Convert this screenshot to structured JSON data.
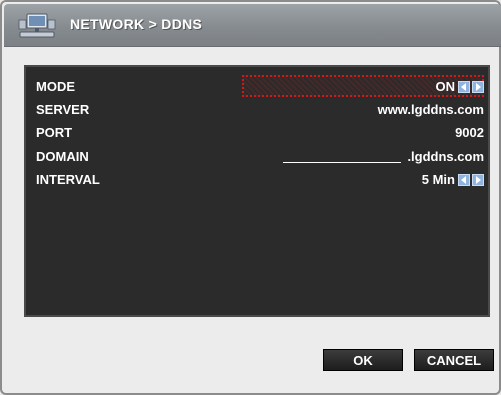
{
  "header": {
    "title": "NETWORK > DDNS",
    "icon": "network-monitor-icon"
  },
  "settings": {
    "mode": {
      "label": "MODE",
      "value": "ON"
    },
    "server": {
      "label": "SERVER",
      "value": "www.lgddns.com"
    },
    "port": {
      "label": "PORT",
      "value": "9002"
    },
    "domain": {
      "label": "DOMAIN",
      "value": "",
      "suffix": ".lgddns.com"
    },
    "interval": {
      "label": "INTERVAL",
      "value": "5 Min"
    }
  },
  "buttons": {
    "ok": "OK",
    "cancel": "CANCEL"
  },
  "colors": {
    "panel": "#2b2b2b",
    "titlebar": "#868b90",
    "highlight": "#d01a1a",
    "arrow": "#8fb4e0"
  }
}
